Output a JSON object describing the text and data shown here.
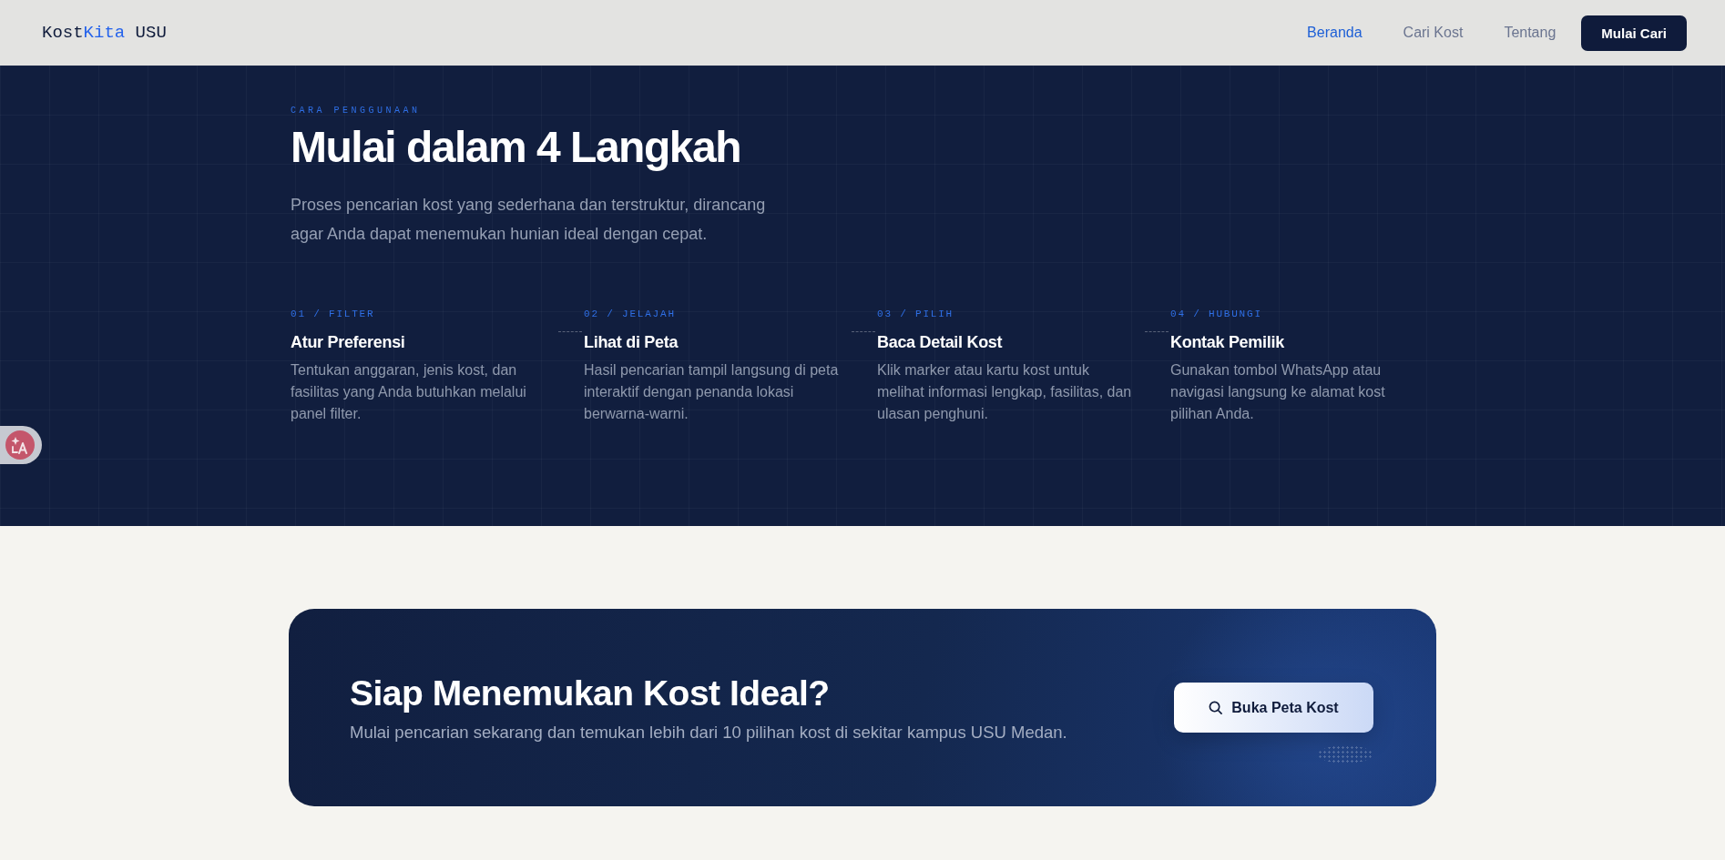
{
  "navbar": {
    "logo": {
      "prefix": "Kost",
      "highlight": "Kita",
      "suffix": " USU"
    },
    "links": [
      {
        "label": "Beranda",
        "selected": true
      },
      {
        "label": "Cari Kost",
        "selected": false
      },
      {
        "label": "Tentang",
        "selected": false
      }
    ],
    "cta_button": "Mulai Cari"
  },
  "how_to": {
    "eyebrow": "CARA PENGGUNAAN",
    "title": "Mulai dalam 4 Langkah",
    "description": "Proses pencarian kost yang sederhana dan terstruktur, dirancang agar Anda dapat menemukan hunian ideal dengan cepat.",
    "steps": [
      {
        "label": "01 / FILTER",
        "title": "Atur Preferensi",
        "description": "Tentukan anggaran, jenis kost, dan fasilitas yang Anda butuhkan melalui panel filter."
      },
      {
        "label": "02 / JELAJAH",
        "title": "Lihat di Peta",
        "description": "Hasil pencarian tampil langsung di peta interaktif dengan penanda lokasi berwarna-warni."
      },
      {
        "label": "03 / PILIH",
        "title": "Baca Detail Kost",
        "description": "Klik marker atau kartu kost untuk melihat informasi lengkap, fasilitas, dan ulasan penghuni."
      },
      {
        "label": "04 / HUBUNGI",
        "title": "Kontak Pemilik",
        "description": "Gunakan tombol WhatsApp atau navigasi langsung ke alamat kost pilihan Anda."
      }
    ]
  },
  "cta": {
    "title": "Siap Menemukan Kost Ideal?",
    "description": "Mulai pencarian sekarang dan temukan lebih dari 10 pilihan kost di sekitar kampus USU Medan.",
    "button": "Buka Peta Kost"
  }
}
